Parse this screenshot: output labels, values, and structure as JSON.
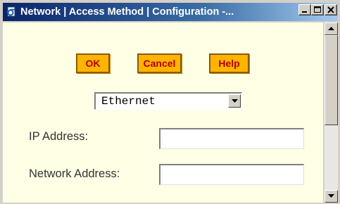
{
  "window": {
    "title": "Network | Access Method | Configuration -...",
    "controls": {
      "minimize": "_",
      "maximize": "□",
      "close": "×"
    }
  },
  "actions": {
    "ok_label": "OK",
    "cancel_label": "Cancel",
    "help_label": "Help"
  },
  "access_method": {
    "selected": "Ethernet"
  },
  "form": {
    "ip_address_label": "IP Address:",
    "ip_address_value": "",
    "network_address_label": "Network Address:",
    "network_address_value": ""
  },
  "colors": {
    "title_gradient_start": "#0a246a",
    "content_background": "#ffffe6",
    "button_fill": "#ffb400",
    "button_text": "#b00000"
  },
  "icons": {
    "app": "ie-document-icon",
    "scroll_up": "arrow-up-icon",
    "scroll_down": "arrow-down-icon",
    "dropdown": "chevron-down-icon"
  }
}
